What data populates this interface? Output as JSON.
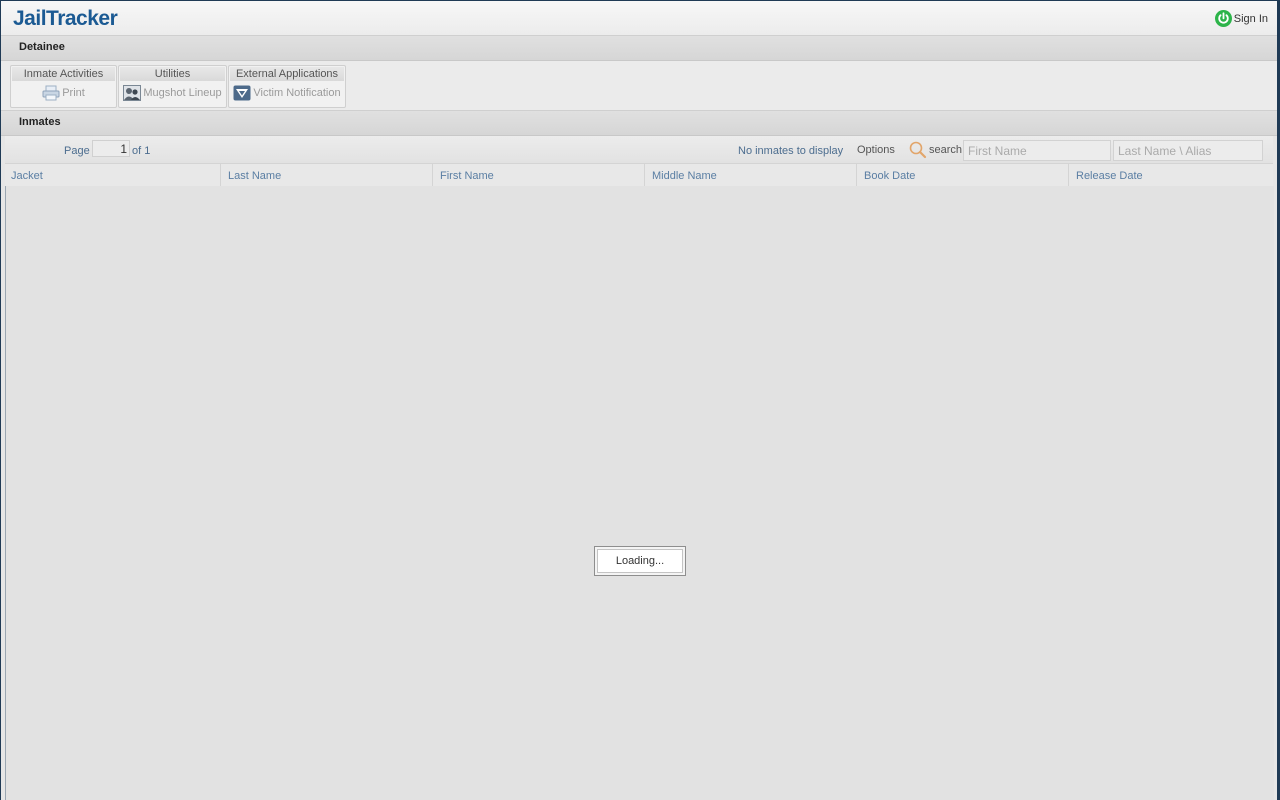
{
  "app": {
    "logo": "JailTracker",
    "signin_label": "Sign In"
  },
  "sections": {
    "detainee": "Detainee",
    "inmates": "Inmates"
  },
  "toolbar": {
    "groups": [
      {
        "title": "Inmate Activities",
        "item": "Print",
        "icon": "printer-icon"
      },
      {
        "title": "Utilities",
        "item": "Mugshot Lineup",
        "icon": "mugshot-lineup-icon"
      },
      {
        "title": "External Applications",
        "item": "Victim Notification",
        "icon": "victim-notification-icon"
      }
    ]
  },
  "pager": {
    "page_label": "Page",
    "page_value": "1",
    "of_label": "of 1",
    "status": "No inmates to display",
    "options_label": "Options",
    "search_label": "search",
    "first_name_placeholder": "First Name",
    "last_name_placeholder": "Last Name \\ Alias"
  },
  "columns": [
    "Jacket",
    "Last Name",
    "First Name",
    "Middle Name",
    "Book Date",
    "Release Date"
  ],
  "loading_text": "Loading...",
  "colors": {
    "brand": "#1b5a93",
    "signin_icon": "#2db44a",
    "header_text": "#5a7ea3"
  }
}
